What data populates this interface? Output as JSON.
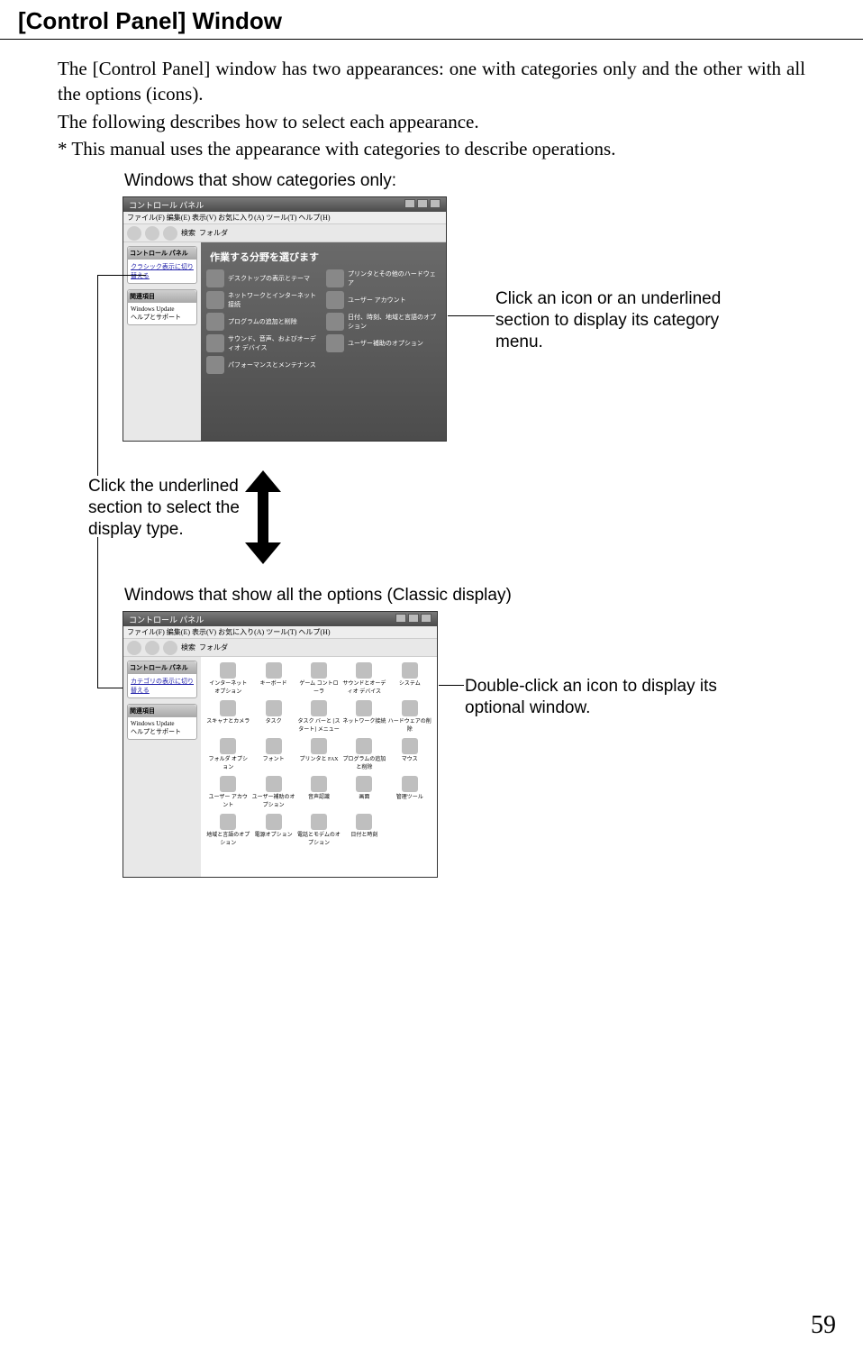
{
  "title": "[Control Panel] Window",
  "paragraphs": {
    "p1": "The [Control Panel] window has two appearances: one with categories only and the other with all the options (icons).",
    "p2": "The following describes how to select each appearance.",
    "p3": "*   This manual uses the appearance with categories to describe operations."
  },
  "captions": {
    "top": "Windows that show categories only:",
    "bottom": "Windows that show all the options (Classic display)"
  },
  "annotations": {
    "right_top": "Click an icon or an underlined section to display its category menu.",
    "left_mid": "Click the underlined section to select the display type.",
    "right_bottom": "Double-click an icon to display its optional window."
  },
  "window": {
    "title": "コントロール パネル",
    "menu": "ファイル(F)   編集(E)   表示(V)   お気に入り(A)   ツール(T)   ヘルプ(H)",
    "toolbar": {
      "search": "検索",
      "folder": "フォルダ"
    },
    "sidebar": {
      "panel1_head": "コントロール パネル",
      "panel1_item": "クラシック表示に切り替える",
      "panel2_head": "関連項目",
      "panel2_items": [
        "Windows Update",
        "ヘルプとサポート"
      ]
    },
    "category_view": {
      "heading": "作業する分野を選びます",
      "items": [
        "デスクトップの表示とテーマ",
        "プリンタとその他のハードウェア",
        "ネットワークとインターネット接続",
        "ユーザー アカウント",
        "プログラムの追加と削除",
        "日付、時刻、地域と言語のオプション",
        "サウンド、音声、およびオーディオ デバイス",
        "ユーザー補助のオプション",
        "パフォーマンスとメンテナンス"
      ]
    },
    "classic_view": {
      "sidebar_panel1_item": "カテゴリの表示に切り替える",
      "items": [
        "インターネット オプション",
        "キーボード",
        "ゲーム コントローラ",
        "サウンドとオーディオ デバイス",
        "システム",
        "スキャナとカメラ",
        "タスク",
        "タスク バーと [スタート] メニュー",
        "ネットワーク接続",
        "ハードウェアの削除",
        "フォルダ オプション",
        "フォント",
        "プリンタと FAX",
        "プログラムの追加と削除",
        "マウス",
        "ユーザー アカウント",
        "ユーザー補助のオプション",
        "音声認識",
        "画面",
        "管理ツール",
        "地域と言語のオプション",
        "電源オプション",
        "電話とモデムのオプション",
        "日付と時刻"
      ]
    }
  },
  "page_number": "59"
}
